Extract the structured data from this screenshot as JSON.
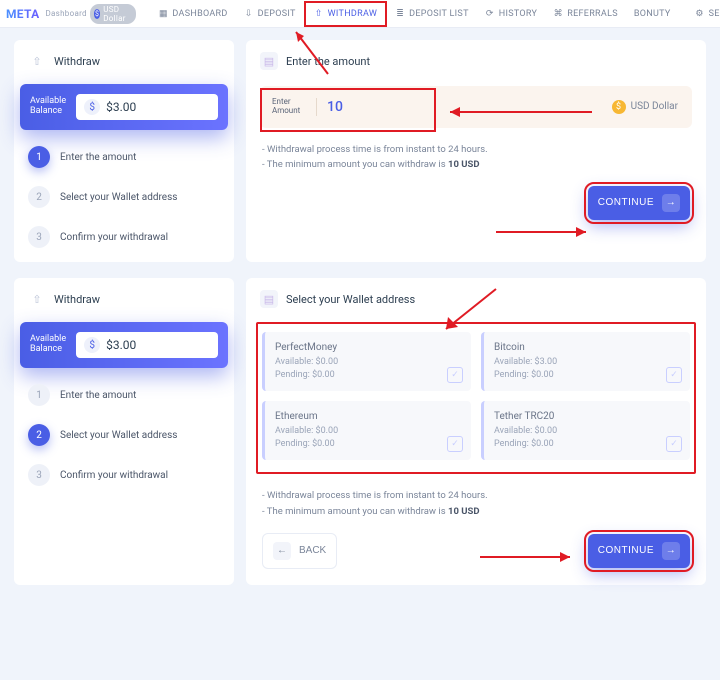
{
  "brand": "META",
  "crumb": "Dashboard",
  "usd_pill": "USD Dollar",
  "nav": {
    "dashboard": "DASHBOARD",
    "deposit": "DEPOSIT",
    "withdraw": "WITHDRAW",
    "deposit_list": "DEPOSIT LIST",
    "history": "HISTORY",
    "referrals": "REFERRALS",
    "bounty": "BONUTY",
    "settings": "SETTINGS"
  },
  "left": {
    "title": "Withdraw",
    "balance_label_1": "Available",
    "balance_label_2": "Balance",
    "balance_value": "$3.00",
    "steps": {
      "s1": "Enter the amount",
      "s2": "Select your Wallet address",
      "s3": "Confirm your withdrawal"
    }
  },
  "amount_panel": {
    "title": "Enter the amount",
    "field_label_1": "Enter",
    "field_label_2": "Amount",
    "value": "10",
    "currency": "USD Dollar",
    "info1": "- Withdrawal process time is from instant to 24 hours.",
    "info2_prefix": "- The minimum amount you can withdraw is ",
    "info2_bold": "10 USD",
    "continue": "CONTINUE"
  },
  "wallet_panel": {
    "title": "Select your Wallet address",
    "back": "BACK",
    "continue": "CONTINUE",
    "wallets": [
      {
        "name": "PerfectMoney",
        "available": "Available: $0.00",
        "pending": "Pending: $0.00"
      },
      {
        "name": "Bitcoin",
        "available": "Available: $3.00",
        "pending": "Pending: $0.00"
      },
      {
        "name": "Ethereum",
        "available": "Available: $0.00",
        "pending": "Pending: $0.00"
      },
      {
        "name": "Tether TRC20",
        "available": "Available: $0.00",
        "pending": "Pending: $0.00"
      }
    ]
  }
}
